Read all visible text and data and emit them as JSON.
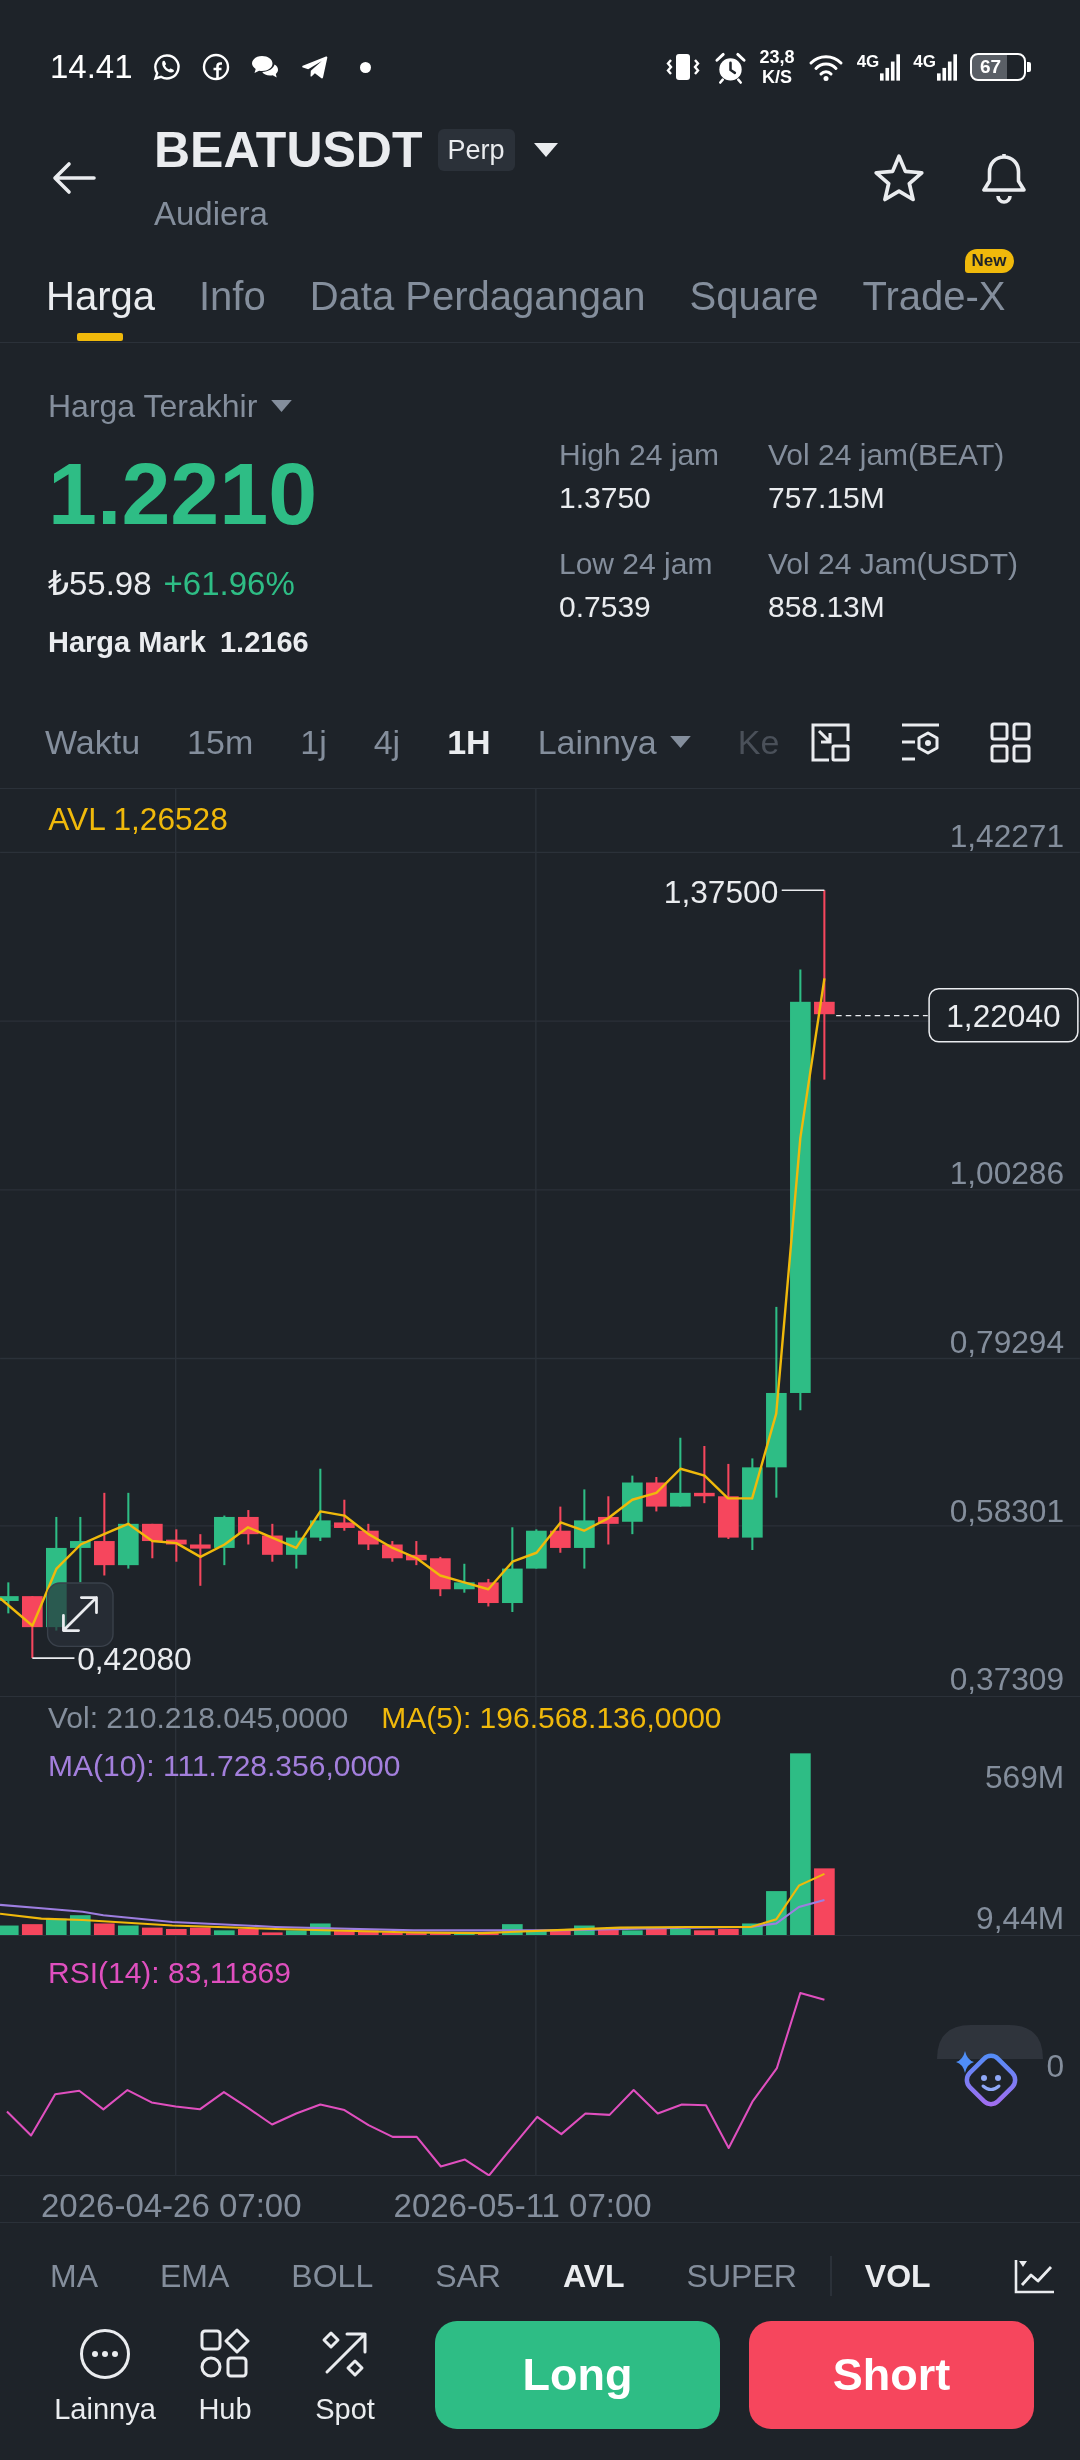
{
  "status_bar": {
    "time": "14.41",
    "net_speed": "23,8",
    "net_speed_unit": "K/S",
    "networks": [
      "4G",
      "4G"
    ],
    "battery": "67"
  },
  "header": {
    "symbol": "BEATUSDT",
    "badge": "Perp",
    "subtitle": "Audiera"
  },
  "tabs": [
    {
      "label": "Harga",
      "selected": true
    },
    {
      "label": "Info",
      "selected": false
    },
    {
      "label": "Data Perdagangan",
      "selected": false
    },
    {
      "label": "Square",
      "selected": false
    },
    {
      "label": "Trade-X",
      "selected": false,
      "badge": "New"
    }
  ],
  "price": {
    "type_label": "Harga Terakhir",
    "last": "1.2210",
    "fiat": "₺55.98",
    "change": "+61.96%",
    "mark_label": "Harga Mark",
    "mark": "1.2166"
  },
  "stats": [
    {
      "label": "High 24 jam",
      "value": "1.3750"
    },
    {
      "label": "Vol 24 jam(BEAT)",
      "value": "757.15M"
    },
    {
      "label": "Low 24 jam",
      "value": "0.7539"
    },
    {
      "label": "Vol 24 Jam(USDT)",
      "value": "858.13M"
    }
  ],
  "intervals": [
    {
      "label": "Waktu",
      "kind": "tab",
      "selected": false
    },
    {
      "label": "15m",
      "kind": "tab",
      "selected": false
    },
    {
      "label": "1j",
      "kind": "tab",
      "selected": false
    },
    {
      "label": "4j",
      "kind": "tab",
      "selected": false
    },
    {
      "label": "1H",
      "kind": "tab",
      "selected": true
    },
    {
      "label": "Lainnya",
      "kind": "dropdown",
      "selected": false
    },
    {
      "label": "Ke",
      "kind": "faded",
      "selected": false
    }
  ],
  "chart": {
    "indicator": "AVL 1,26528",
    "price_axis": [
      "1,42271",
      "1,00286",
      "0,79294",
      "0,58301",
      "0,37309"
    ],
    "last_price": "1,22040",
    "high": "1,37500",
    "low": "0,42080"
  },
  "volume": {
    "vol": "Vol: 210.218.045,0000",
    "ma5": "MA(5): 196.568.136,0000",
    "ma10": "MA(10): 111.728.356,0000",
    "axis": [
      "569M",
      "9,44M"
    ]
  },
  "rsi": {
    "label": "RSI(14): 83,11869",
    "axis": "0"
  },
  "time_axis": [
    "2026-04-26 07:00",
    "2026-05-11 07:00"
  ],
  "indicators": {
    "main": [
      {
        "label": "MA",
        "selected": false
      },
      {
        "label": "EMA",
        "selected": false
      },
      {
        "label": "BOLL",
        "selected": false
      },
      {
        "label": "SAR",
        "selected": false
      },
      {
        "label": "AVL",
        "selected": true
      },
      {
        "label": "SUPER",
        "selected": false
      }
    ],
    "sub": [
      {
        "label": "VOL",
        "selected": true
      }
    ]
  },
  "actions": [
    {
      "label": "Lainnya",
      "kind": "more"
    },
    {
      "label": "Hub",
      "kind": "hub"
    },
    {
      "label": "Spot",
      "kind": "spot"
    }
  ],
  "trade_buttons": [
    {
      "label": "Long",
      "kind": "long"
    },
    {
      "label": "Short",
      "kind": "short"
    }
  ]
}
